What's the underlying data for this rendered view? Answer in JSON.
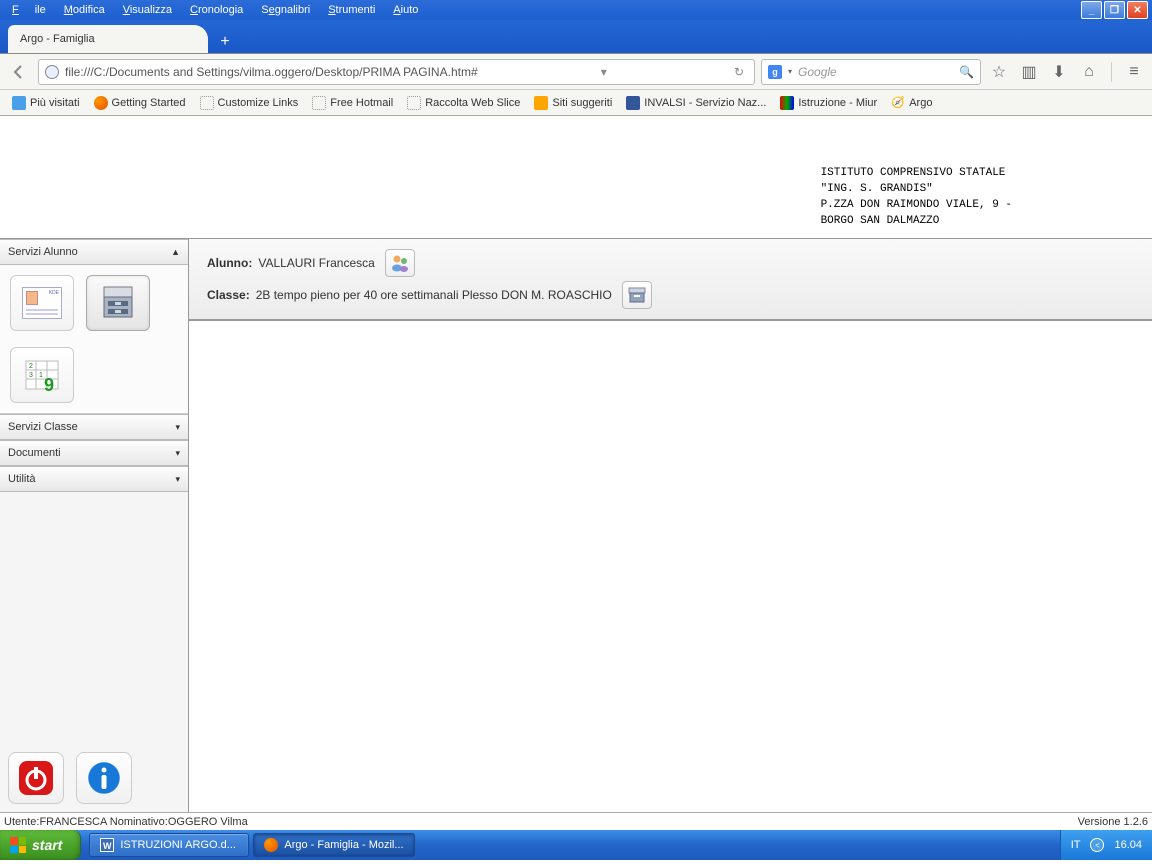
{
  "menu": {
    "file": "File",
    "edit": "Modifica",
    "view": "Visualizza",
    "history": "Cronologia",
    "bookmarks": "Segnalibri",
    "tools": "Strumenti",
    "help": "Aiuto"
  },
  "tab": {
    "title": "Argo - Famiglia"
  },
  "url": {
    "value": "file:///C:/Documents and Settings/vilma.oggero/Desktop/PRIMA PAGINA.htm#"
  },
  "search": {
    "placeholder": "Google"
  },
  "bookmarks": {
    "b1": "Più visitati",
    "b2": "Getting Started",
    "b3": "Customize Links",
    "b4": "Free Hotmail",
    "b5": "Raccolta Web Slice",
    "b6": "Siti suggeriti",
    "b7": "INVALSI - Servizio Naz...",
    "b8": "Istruzione - Miur",
    "b9": "Argo"
  },
  "school": {
    "l1": "ISTITUTO COMPRENSIVO STATALE",
    "l2": "\"ING. S. GRANDIS\"",
    "l3": "P.ZZA DON RAIMONDO VIALE, 9 -",
    "l4": "BORGO SAN DALMAZZO"
  },
  "sidebar": {
    "sec1": "Servizi Alunno",
    "sec2": "Servizi Classe",
    "sec3": "Documenti",
    "sec4": "Utilità"
  },
  "info": {
    "alunno_label": "Alunno:",
    "alunno_value": "VALLAURI Francesca",
    "classe_label": "Classe:",
    "classe_value": "2B tempo pieno per 40 ore settimanali Plesso DON M. ROASCHIO"
  },
  "status": {
    "user": "Utente:FRANCESCA Nominativo:OGGERO Vilma",
    "version": "Versione 1.2.6"
  },
  "taskbar": {
    "start": "start",
    "task1": "ISTRUZIONI ARGO.d...",
    "task2": "Argo - Famiglia - Mozil...",
    "lang": "IT",
    "time": "16.04"
  }
}
